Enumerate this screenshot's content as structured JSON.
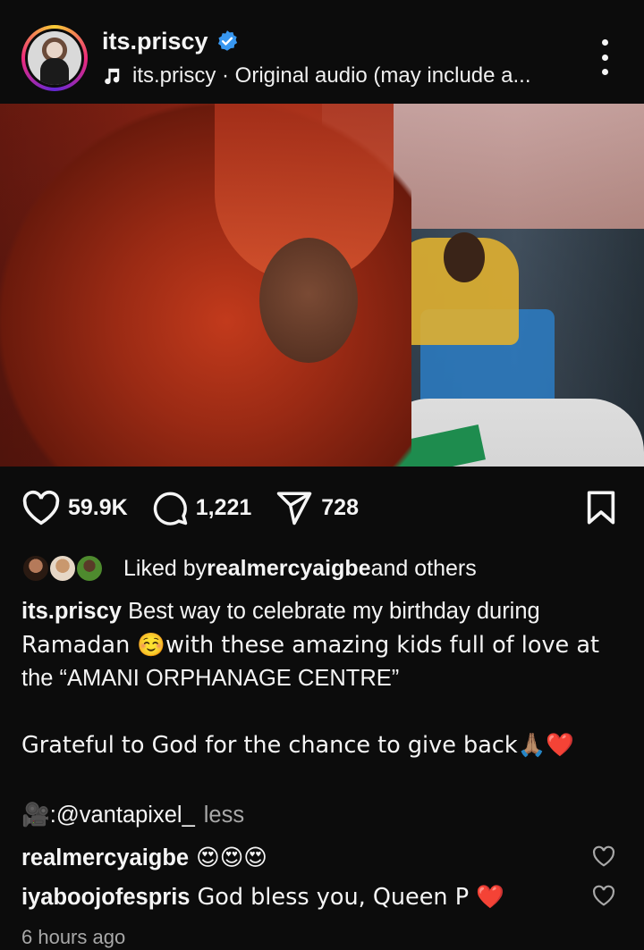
{
  "post": {
    "username": "its.priscy",
    "audio_text": "its.priscy · Original audio (may include a...",
    "verified": true
  },
  "media": {
    "description_icon": "mute-icon"
  },
  "actions": {
    "likes": "59.9K",
    "comments": "1,221",
    "shares": "728"
  },
  "liked_by": {
    "prefix": "Liked by ",
    "user": "realmercyaigbe",
    "suffix": " and others"
  },
  "caption": {
    "user": "its.priscy",
    "text_line1": " Best way to celebrate my birthday during",
    "text_line2": "Ramadan ☺️with these amazing kids full of love at",
    "text_line3": "the “AMANI ORPHANAGE CENTRE”",
    "paragraph2": "Grateful to God for the chance to give back🙏🏽❤️",
    "credit_icon": "🎥",
    "credit_text": ": ",
    "credit_handle": "@vantapixel_",
    "less_label": "less"
  },
  "comments": [
    {
      "user": "realmercyaigbe",
      "text": "😍😍😍"
    },
    {
      "user": "iyaboojofespris",
      "text": "God bless you, Queen P ❤️"
    }
  ],
  "timestamp": "6 hours ago",
  "colors": {
    "background": "#0c0c0c",
    "text": "#f5f5f5",
    "muted": "#a8a8a8",
    "verified": "#3897f0",
    "heart_red": "#e02424"
  }
}
